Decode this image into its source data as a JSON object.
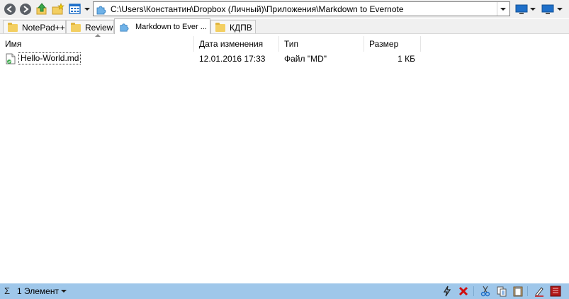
{
  "toolbar": {
    "buttons": [
      "back-icon",
      "forward-icon",
      "up-folder-icon",
      "new-folder-icon",
      "view-mode-icon"
    ],
    "address": {
      "path": "C:\\Users\\Константин\\Dropbox (Личный)\\Приложения\\Markdown to Evernote"
    },
    "right_buttons": [
      "monitor-icon",
      "monitor-icon"
    ]
  },
  "tabs": [
    {
      "label": "NotePad++",
      "icon": "folder-icon",
      "active": false
    },
    {
      "label": "Review",
      "icon": "folder-icon",
      "active": false
    },
    {
      "label": "Markdown to Ever ...",
      "icon": "puzzle-icon",
      "active": true
    },
    {
      "label": "КДПВ",
      "icon": "folder-icon",
      "active": false
    }
  ],
  "columns": {
    "name": "Имя",
    "modified": "Дата изменения",
    "type": "Тип",
    "size": "Размер"
  },
  "files": [
    {
      "name": "Hello-World.md",
      "modified": "12.01.2016 17:33",
      "type": "Файл \"MD\"",
      "size": "1 КБ",
      "icon": "markdown-file-icon"
    }
  ],
  "status": {
    "count_label": "1 Элемент",
    "icons": [
      "lightning-icon",
      "delete-icon",
      "cut-icon",
      "copy-icon",
      "paste-icon",
      "rename-icon",
      "properties-icon"
    ]
  },
  "colors": {
    "status_bar": "#9fc7ea",
    "toolbar": "#f0f0f0",
    "accent_blue": "#1e6fc9"
  }
}
